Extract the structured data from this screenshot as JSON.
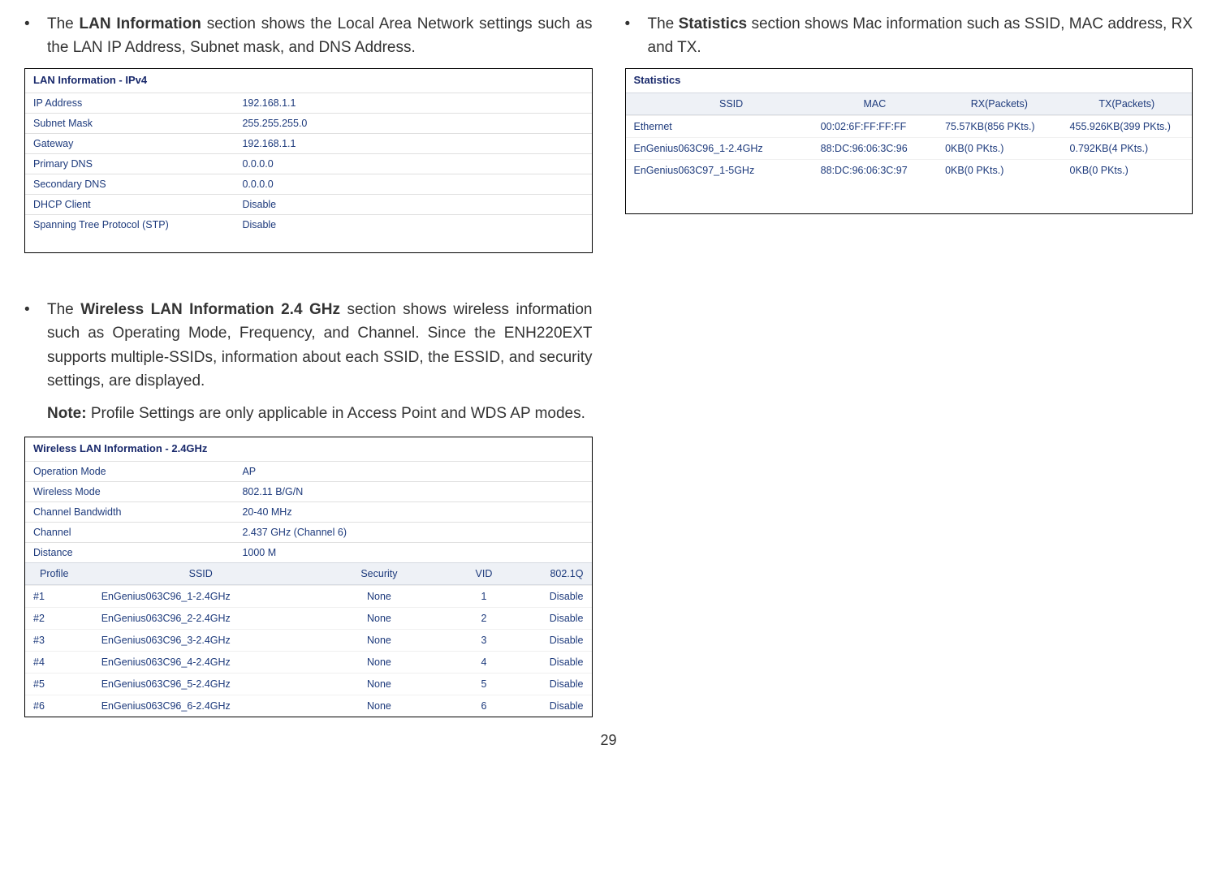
{
  "pageNumber": "29",
  "col1": {
    "bullet": "•",
    "lan": {
      "prefix": "The ",
      "boldTitle": "LAN Information",
      "suffix": " section shows the Local Area Network settings such as the LAN IP Address, Subnet mask, and DNS Address."
    },
    "lanPanel": {
      "title": "LAN Information - IPv4",
      "rows": [
        {
          "label": "IP Address",
          "value": "192.168.1.1"
        },
        {
          "label": "Subnet Mask",
          "value": "255.255.255.0"
        },
        {
          "label": "Gateway",
          "value": "192.168.1.1"
        },
        {
          "label": "Primary DNS",
          "value": "0.0.0.0"
        },
        {
          "label": "Secondary DNS",
          "value": "0.0.0.0"
        },
        {
          "label": "DHCP Client",
          "value": "Disable"
        },
        {
          "label": "Spanning Tree Protocol (STP)",
          "value": "Disable"
        }
      ]
    },
    "wlan": {
      "prefix": "The ",
      "boldTitle": "Wireless LAN Information 2.4 GHz",
      "suffix": " section shows wireless information such as Operating Mode, Frequency, and Channel. Since the ENH220EXT supports multiple-SSIDs, information about each SSID, the ESSID, and security settings, are displayed."
    },
    "note": {
      "bold": "Note:",
      "text": " Profile Settings are only applicable in Access Point and WDS AP modes."
    },
    "wlanPanel": {
      "title": "Wireless LAN Information - 2.4GHz",
      "rows": [
        {
          "label": "Operation Mode",
          "value": "AP"
        },
        {
          "label": "Wireless Mode",
          "value": "802.11 B/G/N"
        },
        {
          "label": "Channel Bandwidth",
          "value": "20-40 MHz"
        },
        {
          "label": "Channel",
          "value": "2.437 GHz (Channel 6)"
        },
        {
          "label": "Distance",
          "value": "1000 M"
        }
      ],
      "ssidHeader": {
        "profile": "Profile",
        "ssid": "SSID",
        "security": "Security",
        "vid": "VID",
        "q": "802.1Q"
      },
      "ssidRows": [
        {
          "profile": "#1",
          "ssid": "EnGenius063C96_1-2.4GHz",
          "security": "None",
          "vid": "1",
          "q": "Disable"
        },
        {
          "profile": "#2",
          "ssid": "EnGenius063C96_2-2.4GHz",
          "security": "None",
          "vid": "2",
          "q": "Disable"
        },
        {
          "profile": "#3",
          "ssid": "EnGenius063C96_3-2.4GHz",
          "security": "None",
          "vid": "3",
          "q": "Disable"
        },
        {
          "profile": "#4",
          "ssid": "EnGenius063C96_4-2.4GHz",
          "security": "None",
          "vid": "4",
          "q": "Disable"
        },
        {
          "profile": "#5",
          "ssid": "EnGenius063C96_5-2.4GHz",
          "security": "None",
          "vid": "5",
          "q": "Disable"
        },
        {
          "profile": "#6",
          "ssid": "EnGenius063C96_6-2.4GHz",
          "security": "None",
          "vid": "6",
          "q": "Disable"
        }
      ]
    }
  },
  "col2": {
    "stats": {
      "prefix": "The ",
      "boldTitle": "Statistics",
      "suffix": " section shows Mac information such as SSID, MAC address, RX and TX."
    },
    "statsPanel": {
      "title": "Statistics",
      "header": {
        "ssid": "SSID",
        "mac": "MAC",
        "rx": "RX(Packets)",
        "tx": "TX(Packets)"
      },
      "rows": [
        {
          "ssid": "Ethernet",
          "mac": "00:02:6F:FF:FF:FF",
          "rx": "75.57KB(856 PKts.)",
          "tx": "455.926KB(399 PKts.)"
        },
        {
          "ssid": "EnGenius063C96_1-2.4GHz",
          "mac": "88:DC:96:06:3C:96",
          "rx": "0KB(0 PKts.)",
          "tx": "0.792KB(4 PKts.)"
        },
        {
          "ssid": "EnGenius063C97_1-5GHz",
          "mac": "88:DC:96:06:3C:97",
          "rx": "0KB(0 PKts.)",
          "tx": "0KB(0 PKts.)"
        }
      ]
    }
  }
}
